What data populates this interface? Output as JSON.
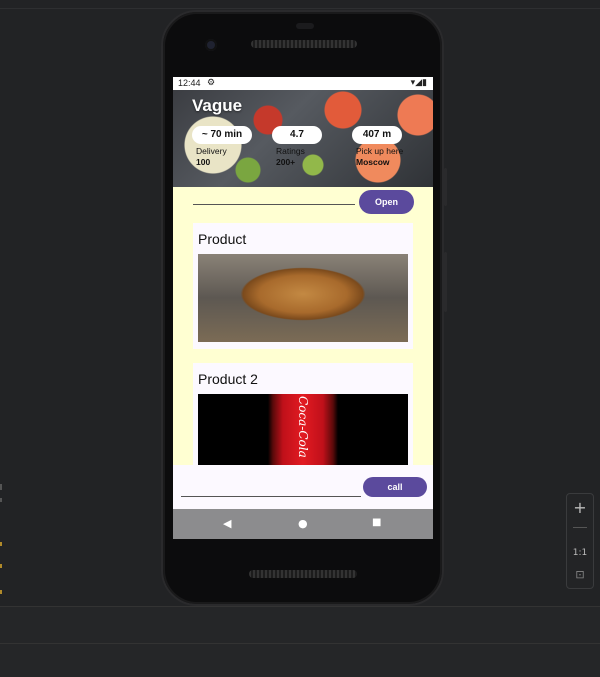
{
  "status_bar": {
    "time": "12:44",
    "settings_icon": "gear-icon",
    "right_icons": "▾◢▮"
  },
  "app": {
    "title": "Vague",
    "stats": [
      {
        "pill": "~ 70 min",
        "label": "Delivery",
        "value": "100"
      },
      {
        "pill": "4.7",
        "label": "Ratings",
        "value": "200+"
      },
      {
        "pill": "407 m",
        "label": "Pick up here",
        "value": "Moscow"
      }
    ],
    "open_button": "Open",
    "cards": [
      {
        "title": "Product",
        "image": "bread-photo"
      },
      {
        "title": "Product 2",
        "image": "cola-bottle-photo",
        "image_text": "Coca-Cola"
      }
    ],
    "call_button": "call"
  },
  "nav": {
    "back": "◀",
    "home": "●",
    "recents": "■"
  },
  "zoom": {
    "plus": "+",
    "minus": "—",
    "reset": "1:1",
    "fit": "⊡"
  }
}
